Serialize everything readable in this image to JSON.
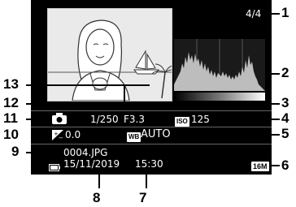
{
  "counter": "4/4",
  "shutter": "1/250",
  "aperture": "F3.3",
  "iso_label": "ISO",
  "iso_value": "125",
  "exposure_comp": "0.0",
  "wb_label": "WB",
  "wb_value": "AUTO",
  "filename": "0004.JPG",
  "date": "15/11/2019",
  "time": "15:30",
  "image_size": "16M",
  "callouts": [
    "1",
    "2",
    "3",
    "4",
    "5",
    "6",
    "7",
    "8",
    "9",
    "10",
    "11",
    "12",
    "13"
  ],
  "icons": {
    "camera": "camera-icon",
    "exposure": "exposure-comp-icon",
    "battery": "battery-icon",
    "photo": "thumbnail-photo"
  }
}
